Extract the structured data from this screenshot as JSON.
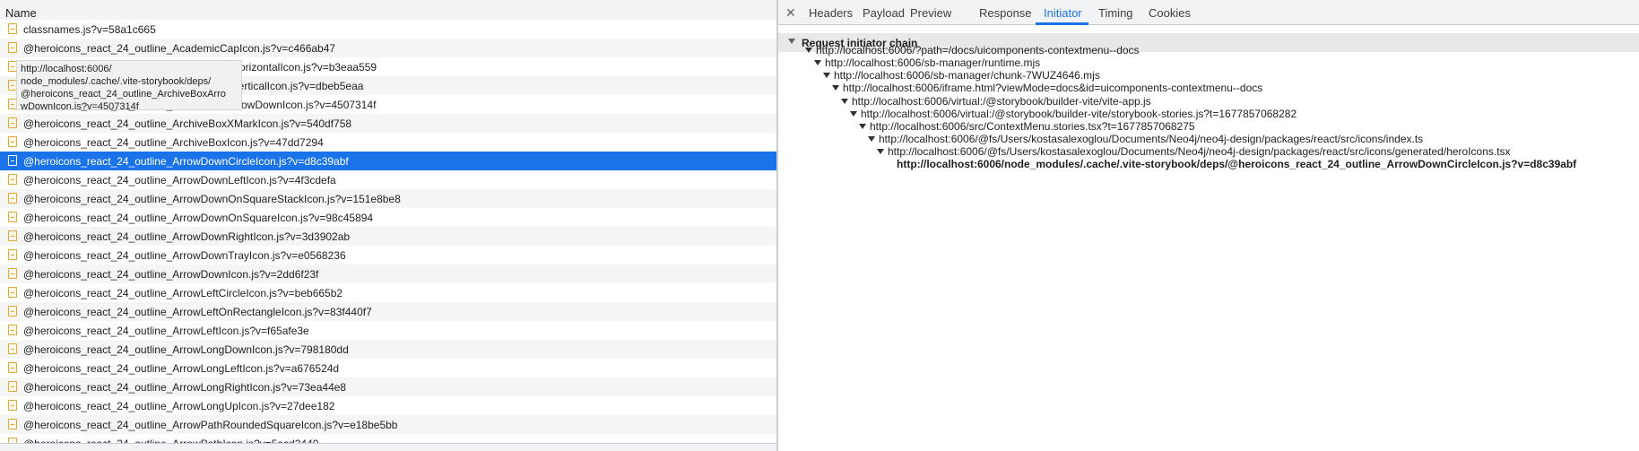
{
  "network": {
    "column_header": "Name",
    "rows": [
      {
        "name": "classnames.js?v=58a1c665"
      },
      {
        "name": "@heroicons_react_24_outline_AcademicCapIcon.js?v=c466ab47"
      },
      {
        "name": "@heroicons_react_24_outline_AdjustmentsHorizontalIcon.js?v=b3eaa559"
      },
      {
        "name": "@heroicons_react_24_outline_AdjustmentsVerticalIcon.js?v=dbeb5eaa"
      },
      {
        "name": "@heroicons_react_24_outline_ArchiveBoxArrowDownIcon.js?v=4507314f"
      },
      {
        "name": "@heroicons_react_24_outline_ArchiveBoxXMarkIcon.js?v=540df758"
      },
      {
        "name": "@heroicons_react_24_outline_ArchiveBoxIcon.js?v=47dd7294"
      },
      {
        "name": "@heroicons_react_24_outline_ArrowDownCircleIcon.js?v=d8c39abf",
        "selected": true
      },
      {
        "name": "@heroicons_react_24_outline_ArrowDownLeftIcon.js?v=4f3cdefa"
      },
      {
        "name": "@heroicons_react_24_outline_ArrowDownOnSquareStackIcon.js?v=151e8be8"
      },
      {
        "name": "@heroicons_react_24_outline_ArrowDownOnSquareIcon.js?v=98c45894"
      },
      {
        "name": "@heroicons_react_24_outline_ArrowDownRightIcon.js?v=3d3902ab"
      },
      {
        "name": "@heroicons_react_24_outline_ArrowDownTrayIcon.js?v=e0568236"
      },
      {
        "name": "@heroicons_react_24_outline_ArrowDownIcon.js?v=2dd6f23f"
      },
      {
        "name": "@heroicons_react_24_outline_ArrowLeftCircleIcon.js?v=beb665b2"
      },
      {
        "name": "@heroicons_react_24_outline_ArrowLeftOnRectangleIcon.js?v=83f440f7"
      },
      {
        "name": "@heroicons_react_24_outline_ArrowLeftIcon.js?v=f65afe3e"
      },
      {
        "name": "@heroicons_react_24_outline_ArrowLongDownIcon.js?v=798180dd"
      },
      {
        "name": "@heroicons_react_24_outline_ArrowLongLeftIcon.js?v=a676524d"
      },
      {
        "name": "@heroicons_react_24_outline_ArrowLongRightIcon.js?v=73ea44e8"
      },
      {
        "name": "@heroicons_react_24_outline_ArrowLongUpIcon.js?v=27dee182"
      },
      {
        "name": "@heroicons_react_24_outline_ArrowPathRoundedSquareIcon.js?v=e18be5bb"
      },
      {
        "name": "@heroicons_react_24_outline_ArrowPathIcon.js?v=5acd2440"
      }
    ],
    "tooltip": "http://localhost:6006/\nnode_modules/.cache/.vite-storybook/deps/\n@heroicons_react_24_outline_ArchiveBoxArro\nwDownIcon.js?v=4507314f"
  },
  "panel": {
    "tabs": [
      "Headers",
      "Payload",
      "Preview",
      "Response",
      "Initiator",
      "Timing",
      "Cookies"
    ],
    "active_tab": "Initiator",
    "section_title": "Request initiator chain",
    "chain": [
      {
        "text": "http://localhost:6006/?path=/docs/uicomponents-contextmenu--docs"
      },
      {
        "text": "http://localhost:6006/sb-manager/runtime.mjs"
      },
      {
        "text": "http://localhost:6006/sb-manager/chunk-7WUZ4646.mjs"
      },
      {
        "text": "http://localhost:6006/iframe.html?viewMode=docs&id=uicomponents-contextmenu--docs"
      },
      {
        "text": "http://localhost:6006/virtual:/@storybook/builder-vite/vite-app.js"
      },
      {
        "text": "http://localhost:6006/virtual:/@storybook/builder-vite/storybook-stories.js?t=1677857068282"
      },
      {
        "text": "http://localhost:6006/src/ContextMenu.stories.tsx?t=1677857068275"
      },
      {
        "text": "http://localhost:6006/@fs/Users/kostasalexoglou/Documents/Neo4j/neo4j-design/packages/react/src/icons/index.ts"
      },
      {
        "text": "http://localhost:6006/@fs/Users/kostasalexoglou/Documents/Neo4j/neo4j-design/packages/react/src/icons/generated/heroIcons.tsx"
      },
      {
        "text": "http://localhost:6006/node_modules/.cache/.vite-storybook/deps/@heroicons_react_24_outline_ArrowDownCircleIcon.js?v=d8c39abf",
        "bold": true
      }
    ]
  }
}
